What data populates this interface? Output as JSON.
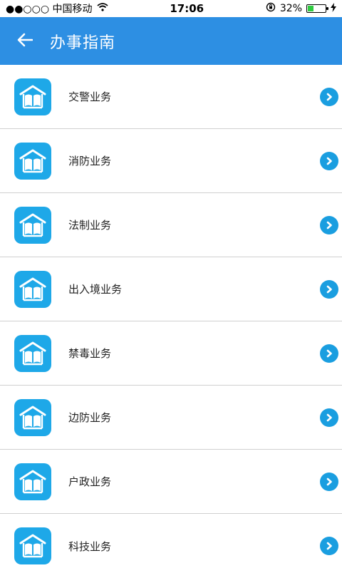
{
  "status_bar": {
    "carrier": "●●○○○ 中国移动",
    "time": "17:06",
    "battery_percent": "32%",
    "battery_level": 0.32
  },
  "header": {
    "title": "办事指南",
    "back_icon": "arrow-left-icon"
  },
  "colors": {
    "appbar": "#2d8fe3",
    "icon_bg": "#1ea8e8",
    "arrow_bg": "#1a9ee0",
    "battery_fill": "#2ecc40"
  },
  "items": [
    {
      "label": "交警业务"
    },
    {
      "label": "消防业务"
    },
    {
      "label": "法制业务"
    },
    {
      "label": "出入境业务"
    },
    {
      "label": "禁毒业务"
    },
    {
      "label": "边防业务"
    },
    {
      "label": "户政业务"
    },
    {
      "label": "科技业务"
    }
  ]
}
